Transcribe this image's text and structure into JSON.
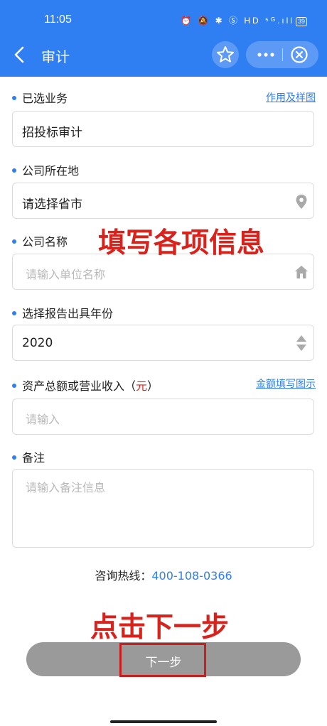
{
  "status_bar": {
    "time": "11:05",
    "icons": "⏰ 🔕 ✱ Ⓢ HD ⁵ᴳ.ıll",
    "battery": "39"
  },
  "nav": {
    "title": "审计"
  },
  "fields": {
    "business": {
      "label": "已选业务",
      "link": "作用及样图",
      "value": "招投标审计"
    },
    "location": {
      "label": "公司所在地",
      "value": "请选择省市"
    },
    "company": {
      "label": "公司名称",
      "placeholder": "请输入单位名称"
    },
    "year": {
      "label": "选择报告出具年份",
      "value": "2020"
    },
    "assets": {
      "label_main": "资产总额或营业收入（",
      "label_unit": "元",
      "label_close": "）",
      "link": "金额填写图示",
      "placeholder": "请输入"
    },
    "remark": {
      "label": "备注",
      "placeholder": "请输入备注信息"
    }
  },
  "overlays": {
    "fill_info": "填写各项信息",
    "click_next": "点击下一步"
  },
  "hotline": {
    "label": "咨询热线：",
    "number": "400-108-0366"
  },
  "next_button": {
    "label": "下一步"
  },
  "colors": {
    "primary": "#2f7ef2",
    "annotation_red": "#d8231d",
    "button_gray": "#9a9a9a"
  }
}
